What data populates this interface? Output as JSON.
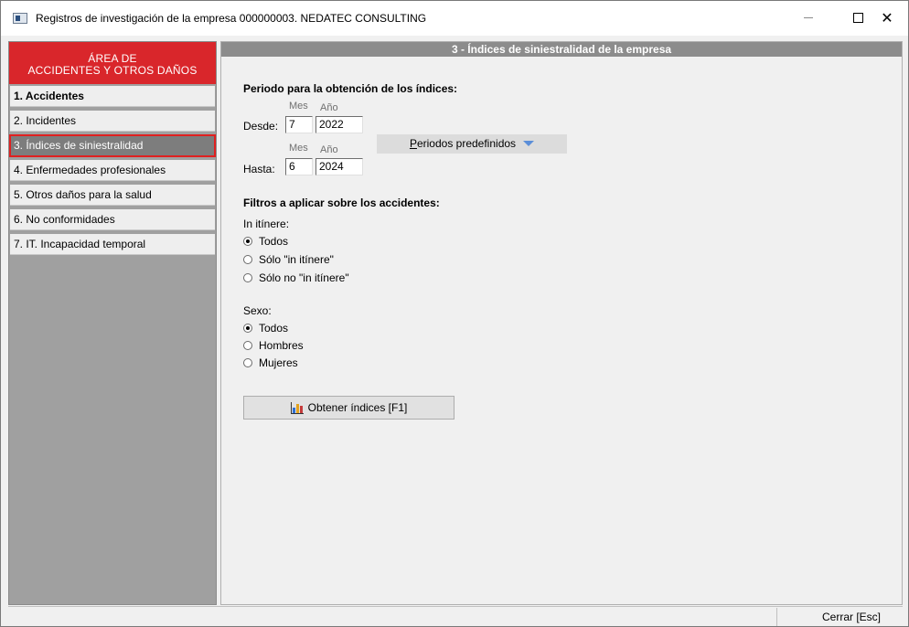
{
  "window": {
    "title": "Registros de investigación de la empresa 000000003. NEDATEC CONSULTING",
    "close_glyph": "✕"
  },
  "sidebar": {
    "header_line1": "ÁREA DE",
    "header_line2": "ACCIDENTES Y OTROS DAÑOS",
    "items": [
      {
        "label": "1. Accidentes"
      },
      {
        "label": "2. Incidentes"
      },
      {
        "label": "3. Índices de siniestralidad"
      },
      {
        "label": "4. Enfermedades profesionales"
      },
      {
        "label": "5. Otros daños para la salud"
      },
      {
        "label": "6. No conformidades"
      },
      {
        "label": "7. IT. Incapacidad temporal"
      }
    ]
  },
  "main": {
    "header": "3 - Índices de siniestralidad de la empresa",
    "period_title": "Periodo para la obtención de los índices:",
    "month_label": "Mes",
    "year_label": "Año",
    "from_label": "Desde:",
    "from_month": "7",
    "from_year": "2022",
    "to_label": "Hasta:",
    "to_month": "6",
    "to_year": "2024",
    "periods_button_underlined": "P",
    "periods_button_rest": "eriodos predefinidos",
    "filters_title": "Filtros a aplicar sobre los accidentes:",
    "in_itinere_label": "In itínere:",
    "in_itinere_options": [
      "Todos",
      "Sólo \"in itínere\"",
      "Sólo no \"in itínere\""
    ],
    "sex_label": "Sexo:",
    "sex_options": [
      "Todos",
      "Hombres",
      "Mujeres"
    ],
    "obtain_button": "Obtener índices  [F1]"
  },
  "status": {
    "close_button": "Cerrar  [Esc]"
  },
  "colors": {
    "accent_red": "#d9262b",
    "header_gray": "#8c8c8c",
    "active_item": "#7d7d7d"
  },
  "icons": [
    "app-icon",
    "minimize-icon",
    "maximize-icon",
    "close-icon",
    "dropdown-arrow-icon",
    "bar-chart-icon"
  ]
}
